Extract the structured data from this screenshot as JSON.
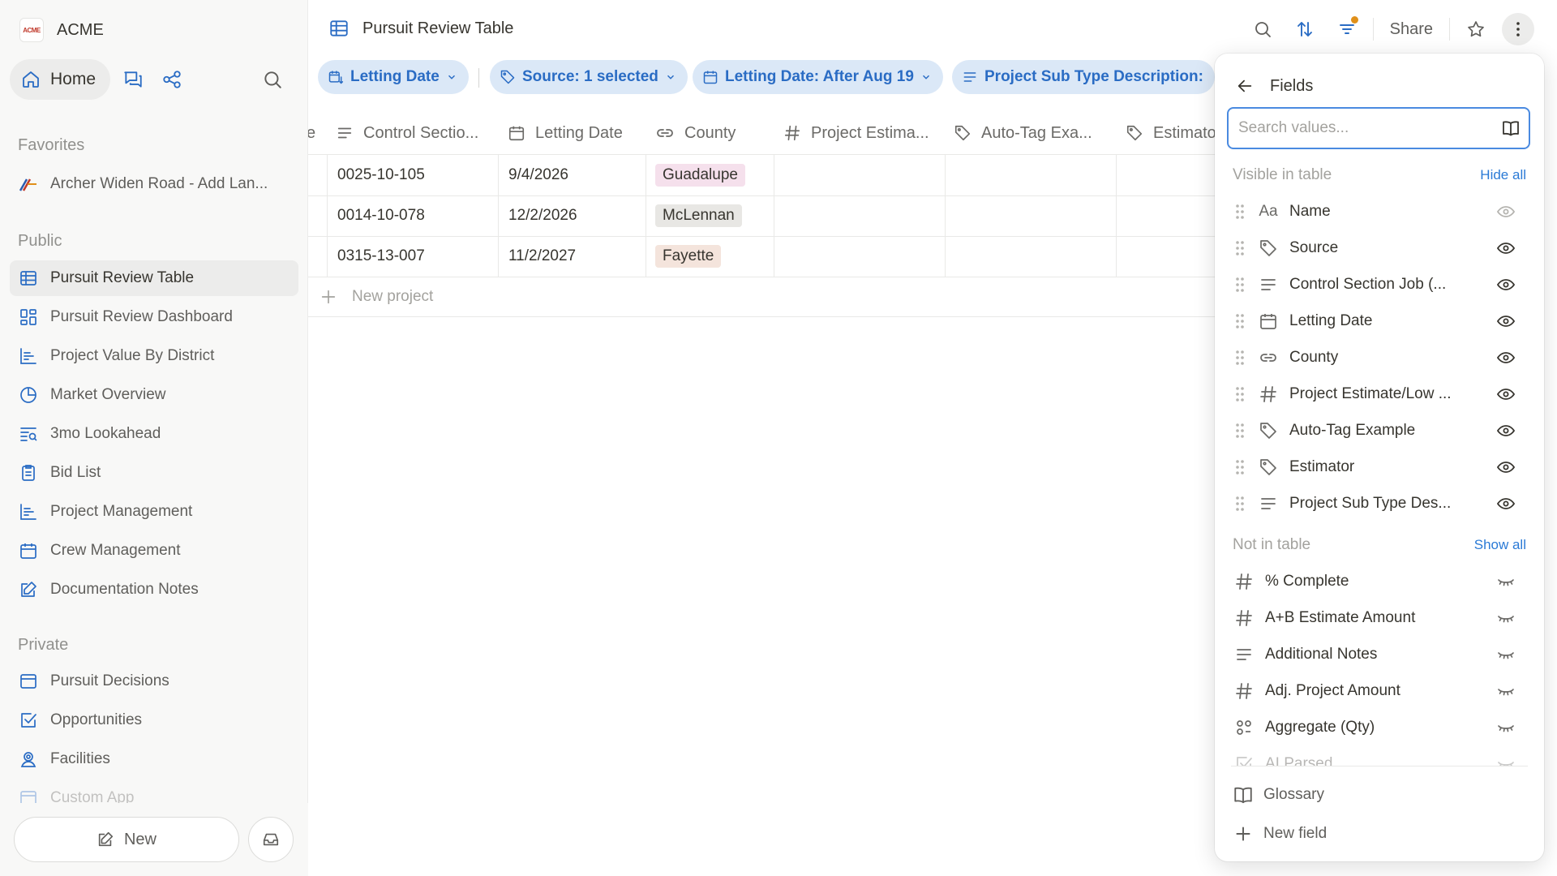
{
  "workspace": {
    "name": "ACME",
    "logo_text": "ACME"
  },
  "nav": {
    "home_label": "Home"
  },
  "sidebar": {
    "favorites_label": "Favorites",
    "favorites": [
      {
        "label": "Archer Widen Road - Add Lan...",
        "icon": "road-sign-icon"
      }
    ],
    "public_label": "Public",
    "public": [
      {
        "label": "Pursuit Review Table",
        "icon": "table-icon",
        "active": true
      },
      {
        "label": "Pursuit Review Dashboard",
        "icon": "dashboard-icon"
      },
      {
        "label": "Project Value By District",
        "icon": "bar-chart-icon"
      },
      {
        "label": "Market Overview",
        "icon": "pie-chart-icon"
      },
      {
        "label": "3mo Lookahead",
        "icon": "lookahead-icon"
      },
      {
        "label": "Bid List",
        "icon": "clipboard-icon"
      },
      {
        "label": "Project Management",
        "icon": "bar-chart-icon"
      },
      {
        "label": "Crew Management",
        "icon": "calendar-icon"
      },
      {
        "label": "Documentation Notes",
        "icon": "note-edit-icon"
      }
    ],
    "private_label": "Private",
    "private": [
      {
        "label": "Pursuit Decisions",
        "icon": "browser-window-icon"
      },
      {
        "label": "Opportunities",
        "icon": "checkbox-icon"
      },
      {
        "label": "Facilities",
        "icon": "person-pin-icon"
      },
      {
        "label": "Custom App",
        "icon": "browser-window-icon"
      }
    ],
    "new_button": "New"
  },
  "header": {
    "title": "Pursuit Review Table",
    "share": "Share"
  },
  "filters": [
    {
      "label": "Letting Date",
      "icon": "calendar-sort-icon"
    },
    {
      "label": "Source: 1 selected",
      "icon": "tag-icon"
    },
    {
      "label": "Letting Date: After Aug 19",
      "icon": "calendar-icon"
    },
    {
      "label": "Project Sub Type Description:",
      "icon": "text-lines-icon"
    }
  ],
  "table": {
    "columns": [
      {
        "label": "e",
        "icon": ""
      },
      {
        "label": "Control Sectio...",
        "icon": "text-lines-icon"
      },
      {
        "label": "Letting Date",
        "icon": "calendar-icon"
      },
      {
        "label": "County",
        "icon": "link-icon"
      },
      {
        "label": "Project Estima...",
        "icon": "hash-icon"
      },
      {
        "label": "Auto-Tag Exa...",
        "icon": "tag-icon"
      },
      {
        "label": "Estimato",
        "icon": "tag-icon"
      }
    ],
    "rows": [
      {
        "control": "0025-10-105",
        "date": "9/4/2026",
        "county": "Guadalupe",
        "county_color": "#f5e0ec"
      },
      {
        "control": "0014-10-078",
        "date": "12/2/2026",
        "county": "McLennan",
        "county_color": "#e8e7e4"
      },
      {
        "control": "0315-13-007",
        "date": "11/2/2027",
        "county": "Fayette",
        "county_color": "#f4e4dc"
      }
    ],
    "new_row": "New project"
  },
  "fields_panel": {
    "title": "Fields",
    "search_placeholder": "Search values...",
    "visible_label": "Visible in table",
    "hide_all": "Hide all",
    "visible": [
      {
        "label": "Name",
        "icon": "text-aa-icon",
        "locked": true
      },
      {
        "label": "Source",
        "icon": "tag-icon"
      },
      {
        "label": "Control Section Job (...",
        "icon": "text-lines-icon"
      },
      {
        "label": "Letting Date",
        "icon": "calendar-icon"
      },
      {
        "label": "County",
        "icon": "link-icon"
      },
      {
        "label": "Project Estimate/Low ...",
        "icon": "hash-icon"
      },
      {
        "label": "Auto-Tag Example",
        "icon": "tag-icon"
      },
      {
        "label": "Estimator",
        "icon": "tag-icon"
      },
      {
        "label": "Project Sub Type Des...",
        "icon": "text-lines-icon"
      }
    ],
    "not_label": "Not in table",
    "show_all": "Show all",
    "not_in_table": [
      {
        "label": "% Complete",
        "icon": "hash-icon"
      },
      {
        "label": "A+B Estimate Amount",
        "icon": "hash-icon"
      },
      {
        "label": "Additional Notes",
        "icon": "text-lines-icon"
      },
      {
        "label": "Adj. Project Amount",
        "icon": "hash-icon"
      },
      {
        "label": "Aggregate (Qty)",
        "icon": "aggregate-icon"
      },
      {
        "label": "AI Parsed",
        "icon": "checkbox-icon"
      }
    ],
    "glossary": "Glossary",
    "new_field": "New field"
  },
  "colors": {
    "accent": "#2a6cc4",
    "chip_bg": "#dbe8f7",
    "focus": "#4a8ae0",
    "dot": "#e0901a"
  }
}
